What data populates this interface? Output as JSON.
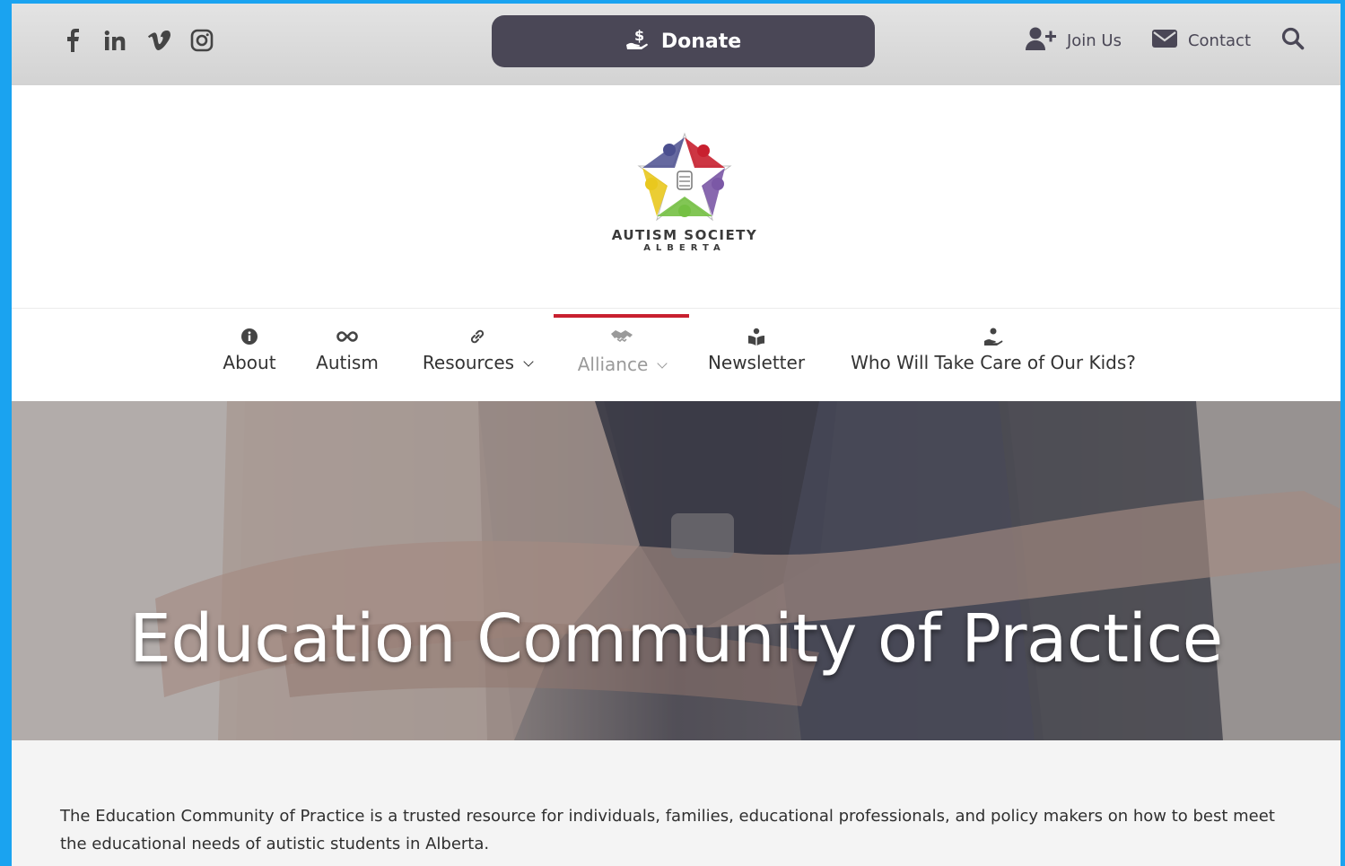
{
  "colors": {
    "background_frame": "#1aa3f0",
    "donate_bg": "#4a4756",
    "active_nav_underline": "#c8202f"
  },
  "social": [
    {
      "name": "facebook-icon",
      "glyph": "f"
    },
    {
      "name": "linkedin-icon",
      "glyph": "in"
    },
    {
      "name": "vimeo-icon",
      "glyph": "v"
    },
    {
      "name": "instagram-icon",
      "glyph": ""
    }
  ],
  "topbar": {
    "donate_label": "Donate",
    "join_label": "Join Us",
    "contact_label": "Contact"
  },
  "logo": {
    "line1": "AUTISM SOCIETY",
    "line2": "ALBERTA"
  },
  "nav": {
    "items": [
      {
        "label": "About",
        "icon": "info-icon"
      },
      {
        "label": "Autism",
        "icon": "infinity-icon"
      },
      {
        "label": "Resources",
        "icon": "link-icon",
        "dropdown": true
      },
      {
        "label": "Alliance",
        "icon": "handshake-icon",
        "dropdown": true,
        "active": true
      },
      {
        "label": "Newsletter",
        "icon": "reader-icon"
      },
      {
        "label": "Who Will Take Care of Our Kids?",
        "icon": "hand-holding-icon"
      }
    ]
  },
  "hero": {
    "title": "Education Community of Practice"
  },
  "intro": {
    "text": "The Education Community of Practice is a trusted resource for individuals, families, educational professionals, and policy makers on how to best meet the educational needs of autistic students in Alberta."
  }
}
